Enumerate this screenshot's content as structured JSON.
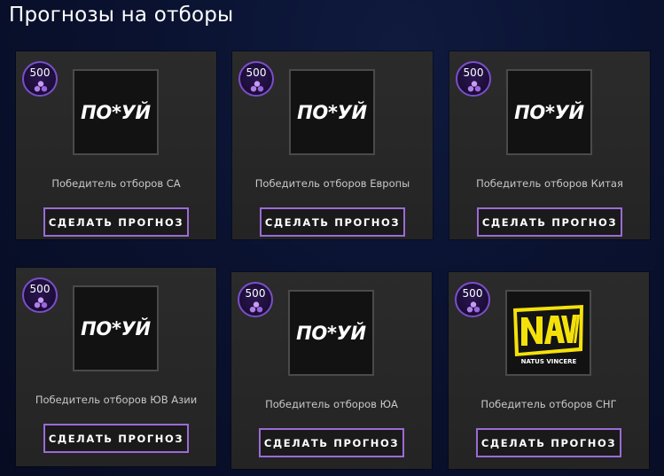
{
  "page": {
    "title": "Прогнозы на отборы"
  },
  "colors": {
    "accent": "#9a6bd6",
    "badge_border": "#7a4fc9",
    "card_bg": "#282828",
    "page_bg": "#0a1230",
    "navi_yellow": "#f5e10a"
  },
  "cards": [
    {
      "cost": "500",
      "cost_icon": "gem-icon",
      "logo_text": "ПО*УЙ",
      "title": "Победитель отборов СА",
      "button_label": "СДЕЛАТЬ ПРОГНОЗ"
    },
    {
      "cost": "500",
      "cost_icon": "gem-icon",
      "logo_text": "ПО*УЙ",
      "title": "Победитель отборов Европы",
      "button_label": "СДЕЛАТЬ ПРОГНОЗ"
    },
    {
      "cost": "500",
      "cost_icon": "gem-icon",
      "logo_text": "ПО*УЙ",
      "title": "Победитель отборов Китая",
      "button_label": "СДЕЛАТЬ ПРОГНОЗ"
    },
    {
      "cost": "500",
      "cost_icon": "gem-icon",
      "logo_text": "ПО*УЙ",
      "title": "Победитель отборов ЮВ Азии",
      "button_label": "СДЕЛАТЬ ПРОГНОЗ"
    },
    {
      "cost": "500",
      "cost_icon": "gem-icon",
      "logo_text": "ПО*УЙ",
      "title": "Победитель отборов ЮА",
      "button_label": "СДЕЛАТЬ ПРОГНОЗ"
    },
    {
      "cost": "500",
      "cost_icon": "gem-icon",
      "logo": "navi-logo",
      "logo_text": "NAVI",
      "logo_subtext": "NATUS VINCERE",
      "title": "Победитель отборов СНГ",
      "button_label": "СДЕЛАТЬ ПРОГНОЗ"
    }
  ]
}
